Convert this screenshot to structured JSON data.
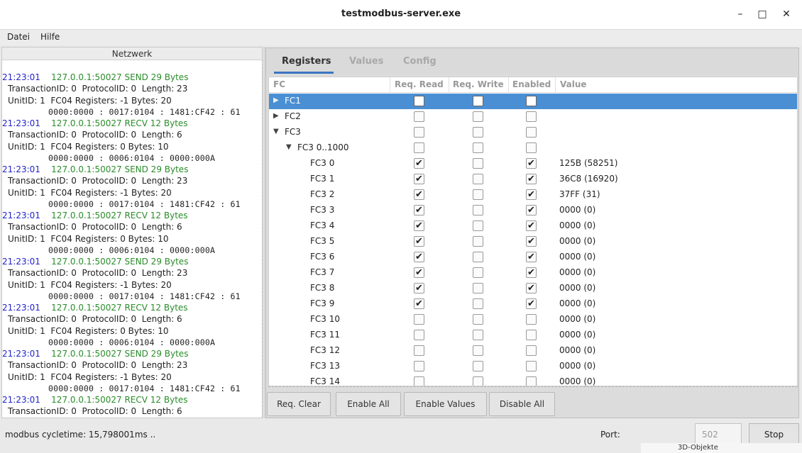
{
  "window": {
    "title": "testmodbus-server.exe",
    "minimize": "–",
    "maximize": "□",
    "close": "✕"
  },
  "menu": {
    "items": [
      "Datei",
      "Hilfe"
    ]
  },
  "network": {
    "header": "Netzwerk",
    "log": [
      {
        "time": "21:23:01",
        "msg": "127.0.0.1:50027 SEND 29 Bytes",
        "l1": "TransactionID: 0  ProtocolID: 0  Length: 23",
        "l2": "UnitID: 1  FC04 Registers: -1 Bytes: 20",
        "hex": "0000:0000 : 0017:0104 : 1481:CF42 : 61"
      },
      {
        "time": "21:23:01",
        "msg": "127.0.0.1:50027 RECV 12 Bytes",
        "l1": "TransactionID: 0  ProtocolID: 0  Length: 6",
        "l2": "UnitID: 1  FC04 Registers: 0 Bytes: 10",
        "hex": "0000:0000 : 0006:0104 : 0000:000A"
      },
      {
        "time": "21:23:01",
        "msg": "127.0.0.1:50027 SEND 29 Bytes",
        "l1": "TransactionID: 0  ProtocolID: 0  Length: 23",
        "l2": "UnitID: 1  FC04 Registers: -1 Bytes: 20",
        "hex": "0000:0000 : 0017:0104 : 1481:CF42 : 61"
      },
      {
        "time": "21:23:01",
        "msg": "127.0.0.1:50027 RECV 12 Bytes",
        "l1": "TransactionID: 0  ProtocolID: 0  Length: 6",
        "l2": "UnitID: 1  FC04 Registers: 0 Bytes: 10",
        "hex": "0000:0000 : 0006:0104 : 0000:000A"
      },
      {
        "time": "21:23:01",
        "msg": "127.0.0.1:50027 SEND 29 Bytes",
        "l1": "TransactionID: 0  ProtocolID: 0  Length: 23",
        "l2": "UnitID: 1  FC04 Registers: -1 Bytes: 20",
        "hex": "0000:0000 : 0017:0104 : 1481:CF42 : 61"
      },
      {
        "time": "21:23:01",
        "msg": "127.0.0.1:50027 RECV 12 Bytes",
        "l1": "TransactionID: 0  ProtocolID: 0  Length: 6",
        "l2": "UnitID: 1  FC04 Registers: 0 Bytes: 10",
        "hex": "0000:0000 : 0006:0104 : 0000:000A"
      },
      {
        "time": "21:23:01",
        "msg": "127.0.0.1:50027 SEND 29 Bytes",
        "l1": "TransactionID: 0  ProtocolID: 0  Length: 23",
        "l2": "UnitID: 1  FC04 Registers: -1 Bytes: 20",
        "hex": "0000:0000 : 0017:0104 : 1481:CF42 : 61"
      },
      {
        "time": "21:23:01",
        "msg": "127.0.0.1:50027 RECV 12 Bytes",
        "l1": "TransactionID: 0  ProtocolID: 0  Length: 6"
      }
    ]
  },
  "tabs": [
    "Registers",
    "Values",
    "Config"
  ],
  "table": {
    "columns": [
      "FC",
      "Req. Read",
      "Req. Write",
      "Enabled",
      "Value"
    ],
    "rows": [
      {
        "name": "FC1",
        "level": 0,
        "expander": "collapsed",
        "read": false,
        "write": false,
        "enabled": false,
        "value": "",
        "selected": true
      },
      {
        "name": "FC2",
        "level": 0,
        "expander": "collapsed",
        "read": false,
        "write": false,
        "enabled": false,
        "value": ""
      },
      {
        "name": "FC3",
        "level": 0,
        "expander": "expanded",
        "read": false,
        "write": false,
        "enabled": false,
        "value": ""
      },
      {
        "name": "FC3 0..1000",
        "level": 1,
        "expander": "expanded",
        "read": false,
        "write": false,
        "enabled": false,
        "value": ""
      },
      {
        "name": "FC3 0",
        "level": 2,
        "read": true,
        "write": false,
        "enabled": true,
        "value": "125B (58251)"
      },
      {
        "name": "FC3 1",
        "level": 2,
        "read": true,
        "write": false,
        "enabled": true,
        "value": "36C8 (16920)"
      },
      {
        "name": "FC3 2",
        "level": 2,
        "read": true,
        "write": false,
        "enabled": true,
        "value": "37FF (31)"
      },
      {
        "name": "FC3 3",
        "level": 2,
        "read": true,
        "write": false,
        "enabled": true,
        "value": "0000 (0)"
      },
      {
        "name": "FC3 4",
        "level": 2,
        "read": true,
        "write": false,
        "enabled": true,
        "value": "0000 (0)"
      },
      {
        "name": "FC3 5",
        "level": 2,
        "read": true,
        "write": false,
        "enabled": true,
        "value": "0000 (0)"
      },
      {
        "name": "FC3 6",
        "level": 2,
        "read": true,
        "write": false,
        "enabled": true,
        "value": "0000 (0)"
      },
      {
        "name": "FC3 7",
        "level": 2,
        "read": true,
        "write": false,
        "enabled": true,
        "value": "0000 (0)"
      },
      {
        "name": "FC3 8",
        "level": 2,
        "read": true,
        "write": false,
        "enabled": true,
        "value": "0000 (0)"
      },
      {
        "name": "FC3 9",
        "level": 2,
        "read": true,
        "write": false,
        "enabled": true,
        "value": "0000 (0)"
      },
      {
        "name": "FC3 10",
        "level": 2,
        "read": false,
        "write": false,
        "enabled": false,
        "value": "0000 (0)"
      },
      {
        "name": "FC3 11",
        "level": 2,
        "read": false,
        "write": false,
        "enabled": false,
        "value": "0000 (0)"
      },
      {
        "name": "FC3 12",
        "level": 2,
        "read": false,
        "write": false,
        "enabled": false,
        "value": "0000 (0)"
      },
      {
        "name": "FC3 13",
        "level": 2,
        "read": false,
        "write": false,
        "enabled": false,
        "value": "0000 (0)"
      },
      {
        "name": "FC3 14",
        "level": 2,
        "read": false,
        "write": false,
        "enabled": false,
        "value": "0000 (0)"
      }
    ]
  },
  "buttons": [
    "Req. Clear",
    "Enable All",
    "Enable Values",
    "Disable All"
  ],
  "status": {
    "cycletime": "modbus cycletime: 15,798001ms   ..",
    "port_label": "Port:",
    "port_value": "502",
    "stop": "Stop"
  },
  "background_peek": "3D-Objekte"
}
